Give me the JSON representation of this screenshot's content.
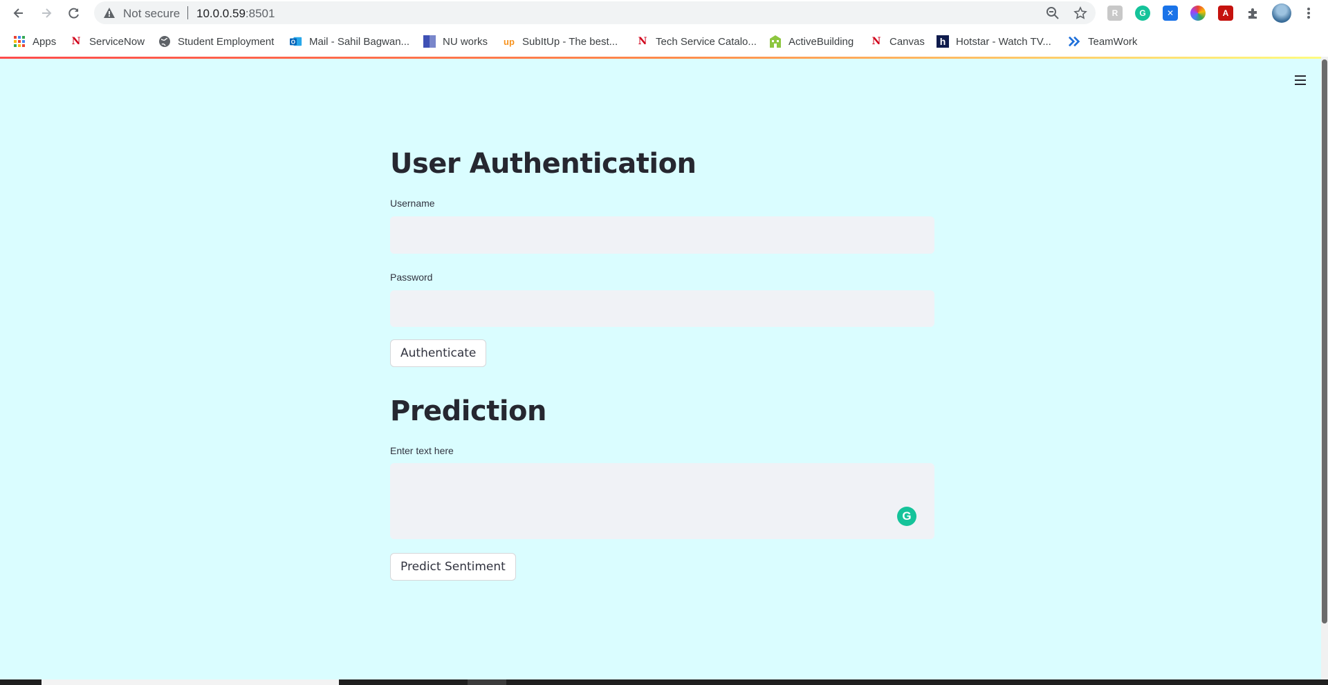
{
  "browser": {
    "security_label": "Not secure",
    "url_host": "10.0.0.59",
    "url_port": ":8501",
    "icons": [
      "back-icon",
      "forward-icon",
      "reload-icon",
      "warning-icon",
      "zoom-icon",
      "star-icon",
      "puzzle-icon",
      "kebab-menu-icon"
    ]
  },
  "bookmarks": [
    {
      "label": "Apps",
      "icon": "apps-grid-icon"
    },
    {
      "label": "ServiceNow",
      "icon": "servicenow-icon"
    },
    {
      "label": "Student Employment",
      "icon": "globe-icon"
    },
    {
      "label": "Mail - Sahil Bagwan...",
      "icon": "outlook-icon"
    },
    {
      "label": "NU works",
      "icon": "nuworks-icon"
    },
    {
      "label": "SubItUp - The best...",
      "icon": "subitup-icon"
    },
    {
      "label": "Tech Service Catalo...",
      "icon": "servicenow-icon"
    },
    {
      "label": "ActiveBuilding",
      "icon": "building-icon"
    },
    {
      "label": "Canvas",
      "icon": "servicenow-icon"
    },
    {
      "label": "Hotstar - Watch TV...",
      "icon": "hotstar-icon"
    },
    {
      "label": "TeamWork",
      "icon": "teamwork-icon"
    }
  ],
  "app": {
    "auth_title": "User Authentication",
    "username_label": "Username",
    "username_value": "",
    "password_label": "Password",
    "password_value": "",
    "authenticate_label": "Authenticate",
    "prediction_title": "Prediction",
    "text_label": "Enter text here",
    "text_value": "",
    "predict_label": "Predict Sentiment"
  },
  "colors": {
    "app_background": "#dafdff",
    "heading": "#262730",
    "input_background": "#f0f2f6",
    "grammarly": "#15c39a"
  }
}
